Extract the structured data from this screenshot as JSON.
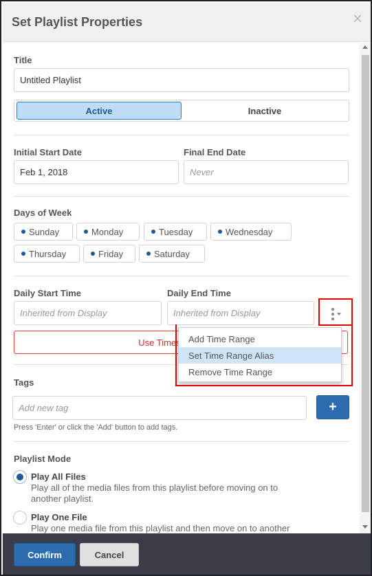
{
  "header": {
    "title": "Set Playlist Properties",
    "close_glyph": "×"
  },
  "title_section": {
    "label": "Title",
    "value": "Untitled Playlist"
  },
  "status_toggle": {
    "active": "Active",
    "inactive": "Inactive",
    "selected": "Active"
  },
  "dates": {
    "start_label": "Initial Start Date",
    "start_value": "Feb 1, 2018",
    "end_label": "Final End Date",
    "end_placeholder": "Never"
  },
  "days": {
    "label": "Days of Week",
    "items": [
      "Sunday",
      "Monday",
      "Tuesday",
      "Wednesday",
      "Thursday",
      "Friday",
      "Saturday"
    ]
  },
  "times": {
    "start_label": "Daily Start Time",
    "start_placeholder": "Inherited from Display",
    "end_label": "Daily End Time",
    "end_placeholder": "Inherited from Display",
    "use_display_button": "Use Times from Displ"
  },
  "time_menu": {
    "icon": "kebab-menu-icon",
    "items": [
      "Add Time Range",
      "Set Time Range Alias",
      "Remove Time Range"
    ],
    "highlighted": "Set Time Range Alias"
  },
  "tags": {
    "label": "Tags",
    "placeholder": "Add new tag",
    "add_glyph": "+",
    "hint": "Press 'Enter' or click the 'Add' button to add tags."
  },
  "playlist_mode": {
    "label": "Playlist Mode",
    "options": [
      {
        "title": "Play All Files",
        "desc_line1": "Play all of the media files from this playlist before moving on to",
        "desc_line2": "another playlist.",
        "checked": true
      },
      {
        "title": "Play One File",
        "desc_line1": "Play one media file from this playlist and then move on to another",
        "desc_line2": "",
        "checked": false
      }
    ]
  },
  "footer": {
    "confirm": "Confirm",
    "cancel": "Cancel"
  },
  "colors": {
    "accent": "#2c6db0",
    "highlight_box": "#e00000",
    "footer_bg": "#3a3d48"
  }
}
